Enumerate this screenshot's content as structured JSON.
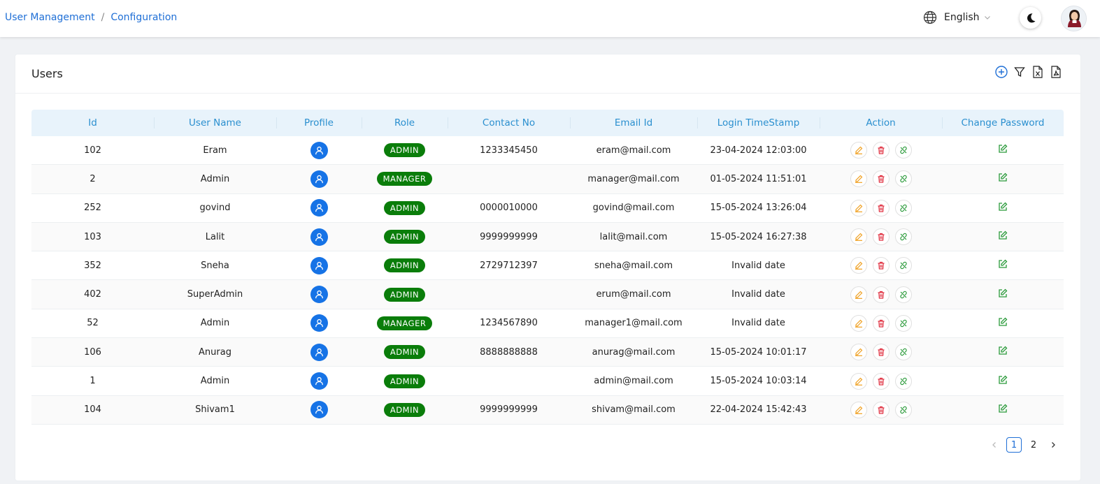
{
  "breadcrumb": {
    "items": [
      "User Management",
      "Configuration"
    ],
    "separator": "/"
  },
  "header": {
    "language": "English"
  },
  "card": {
    "title": "Users"
  },
  "table": {
    "columns": [
      "Id",
      "User Name",
      "Profile",
      "Role",
      "Contact No",
      "Email Id",
      "Login TimeStamp",
      "Action",
      "Change Password"
    ],
    "rows": [
      {
        "id": "102",
        "name": "Eram",
        "role": "ADMIN",
        "contact": "1233345450",
        "email": "eram@mail.com",
        "ts": "23-04-2024 12:03:00"
      },
      {
        "id": "2",
        "name": "Admin",
        "role": "MANAGER",
        "contact": "",
        "email": "manager@mail.com",
        "ts": "01-05-2024 11:51:01"
      },
      {
        "id": "252",
        "name": "govind",
        "role": "ADMIN",
        "contact": "0000010000",
        "email": "govind@mail.com",
        "ts": "15-05-2024 13:26:04"
      },
      {
        "id": "103",
        "name": "Lalit",
        "role": "ADMIN",
        "contact": "9999999999",
        "email": "lalit@mail.com",
        "ts": "15-05-2024 16:27:38"
      },
      {
        "id": "352",
        "name": "Sneha",
        "role": "ADMIN",
        "contact": "2729712397",
        "email": "sneha@mail.com",
        "ts": "Invalid date"
      },
      {
        "id": "402",
        "name": "SuperAdmin",
        "role": "ADMIN",
        "contact": "",
        "email": "erum@mail.com",
        "ts": "Invalid date"
      },
      {
        "id": "52",
        "name": "Admin",
        "role": "MANAGER",
        "contact": "1234567890",
        "email": "manager1@mail.com",
        "ts": "Invalid date"
      },
      {
        "id": "106",
        "name": "Anurag",
        "role": "ADMIN",
        "contact": "8888888888",
        "email": "anurag@mail.com",
        "ts": "15-05-2024 10:01:17"
      },
      {
        "id": "1",
        "name": "Admin",
        "role": "ADMIN",
        "contact": "",
        "email": "admin@mail.com",
        "ts": "15-05-2024 10:03:14"
      },
      {
        "id": "104",
        "name": "Shivam1",
        "role": "ADMIN",
        "contact": "9999999999",
        "email": "shivam@mail.com",
        "ts": "22-04-2024 15:42:43"
      }
    ]
  },
  "pagination": {
    "pages": [
      "1",
      "2"
    ],
    "current": "1"
  },
  "colors": {
    "accent": "#1f6fd6",
    "header_text": "#2a8fcf",
    "badge": "#0a7d0a",
    "edit": "#f0a020",
    "delete": "#e03040",
    "unlink": "#2a9a3a"
  },
  "icons": {
    "language": "globe-icon",
    "theme": "moon-icon",
    "add": "plus-circle-icon",
    "filter": "filter-icon",
    "excel": "file-excel-icon",
    "pdf": "file-pdf-icon",
    "profile": "user-icon",
    "edit": "pencil-icon",
    "delete": "trash-icon",
    "unlink": "unlink-icon",
    "change_password": "edit-square-icon"
  }
}
